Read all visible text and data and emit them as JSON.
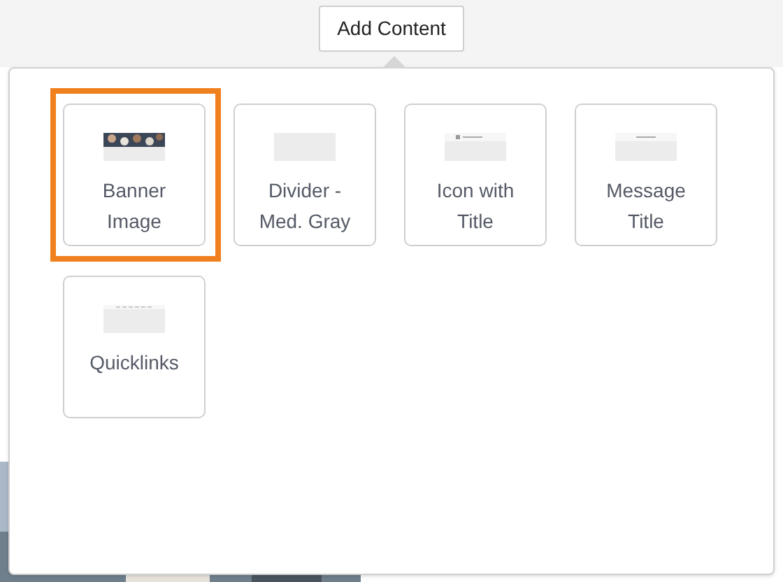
{
  "add_button": {
    "label": "Add Content"
  },
  "content_blocks": [
    {
      "label": "Banner Image",
      "kind": "banner",
      "selected": true
    },
    {
      "label": "Divider - Med. Gray",
      "kind": "divider",
      "selected": false
    },
    {
      "label": "Icon with Title",
      "kind": "icon_title",
      "selected": false
    },
    {
      "label": "Message Title",
      "kind": "message_title",
      "selected": false
    },
    {
      "label": "Quicklinks",
      "kind": "quicklinks",
      "selected": false
    }
  ]
}
